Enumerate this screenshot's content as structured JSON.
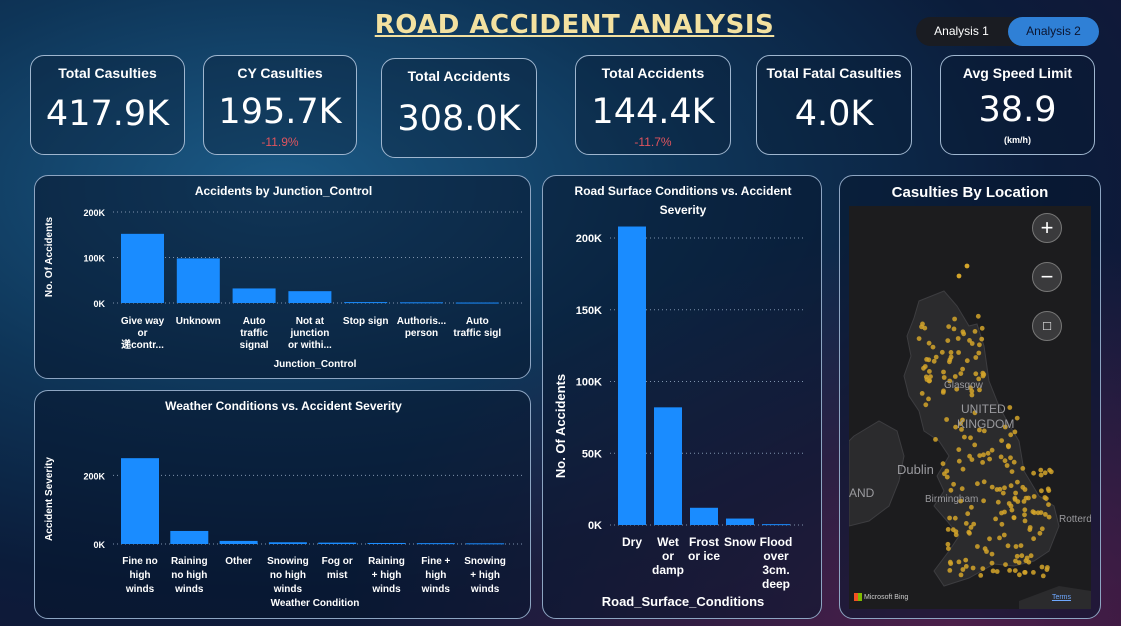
{
  "header": {
    "title": "ROAD ACCIDENT ANALYSIS",
    "tab1": "Analysis 1",
    "tab2": "Analysis 2"
  },
  "kpis": {
    "total_casulties": {
      "label": "Total Casulties",
      "value": "417.9K"
    },
    "cy_casulties": {
      "label": "CY Casulties",
      "value": "195.7K",
      "delta": "-11.9%"
    },
    "total_accidents": {
      "label": "Total Accidents",
      "value": "308.0K"
    },
    "cy_accidents": {
      "label": "Total Accidents",
      "value": "144.4K",
      "delta": "-11.7%"
    },
    "fatal": {
      "label": "Total Fatal Casulties",
      "value": "4.0K"
    },
    "speed": {
      "label": "Avg Speed Limit",
      "value": "38.9",
      "unit": "(km/h)"
    }
  },
  "map": {
    "title": "Casulties By Location",
    "attribution": "Microsoft Bing",
    "terms": "Terms",
    "places": [
      "UNITED",
      "KINGDOM",
      "Dublin",
      "Birmingham",
      "Glasgow",
      "AND",
      "Rotterd"
    ]
  },
  "chart_data": [
    {
      "type": "bar",
      "title": "Accidents by Junction_Control",
      "xlabel": "Junction_Control",
      "ylabel": "No. Of Accidents",
      "yticks": [
        "0K",
        "100K",
        "200K"
      ],
      "ylim": [
        0,
        200000
      ],
      "grid": true,
      "categories": [
        [
          "Give way",
          "or",
          "递contr..."
        ],
        [
          "Unknown"
        ],
        [
          "Auto",
          "traffic",
          "signal"
        ],
        [
          "Not at",
          "junction",
          "or withi..."
        ],
        [
          "Stop sign"
        ],
        [
          "Authoris...",
          "person"
        ],
        [
          "Auto",
          "traffic sigl"
        ]
      ],
      "values": [
        152000,
        98000,
        32000,
        26000,
        2000,
        1500,
        1000
      ]
    },
    {
      "type": "bar",
      "title": "Weather Conditions vs. Accident Severity",
      "xlabel": "Weather Condition",
      "ylabel": "Accident Severity",
      "yticks": [
        "0K",
        "200K"
      ],
      "ylim": [
        0,
        300000
      ],
      "grid": true,
      "categories": [
        [
          "Fine no",
          "high",
          "winds"
        ],
        [
          "Raining",
          "no high",
          "winds"
        ],
        [
          "Other"
        ],
        [
          "Snowing",
          "no high",
          "winds"
        ],
        [
          "Fog or",
          "mist"
        ],
        [
          "Raining",
          "+ high",
          "winds"
        ],
        [
          "Fine +",
          "high",
          "winds"
        ],
        [
          "Snowing",
          "+ high",
          "winds"
        ]
      ],
      "values": [
        250000,
        38000,
        9000,
        5000,
        4000,
        3000,
        2500,
        2000
      ]
    },
    {
      "type": "bar",
      "title": [
        "Road Surface Conditions vs. Accident",
        "Severity"
      ],
      "xlabel": "Road_Surface_Conditions",
      "ylabel": "No. Of Accidents",
      "yticks": [
        "0K",
        "50K",
        "100K",
        "150K",
        "200K"
      ],
      "ylim": [
        0,
        200000
      ],
      "grid": true,
      "categories": [
        [
          "Dry"
        ],
        [
          "Wet",
          "or",
          "damp"
        ],
        [
          "Frost",
          "or ice"
        ],
        [
          "Snow"
        ],
        [
          "Flood",
          "over",
          "3cm.",
          "deep"
        ]
      ],
      "values": [
        208000,
        82000,
        12000,
        4500,
        600
      ]
    }
  ],
  "colors": {
    "bar": "#1a8cff",
    "accent_title": "#f3e1a0",
    "negative": "#e0545e",
    "map_dot": "#d4a52a"
  }
}
